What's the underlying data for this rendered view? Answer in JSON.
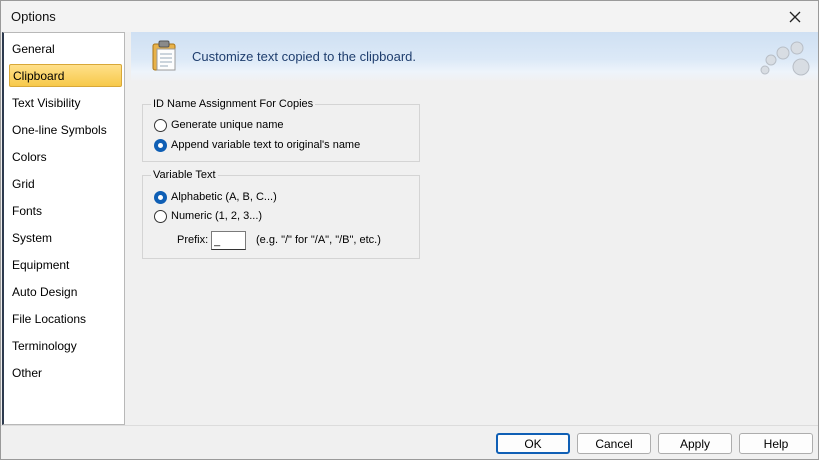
{
  "window": {
    "title": "Options"
  },
  "sidebar": {
    "items": [
      {
        "label": "General"
      },
      {
        "label": "Clipboard",
        "selected": true
      },
      {
        "label": "Text Visibility"
      },
      {
        "label": "One-line Symbols"
      },
      {
        "label": "Colors"
      },
      {
        "label": "Grid"
      },
      {
        "label": "Fonts"
      },
      {
        "label": "System"
      },
      {
        "label": "Equipment"
      },
      {
        "label": "Auto Design"
      },
      {
        "label": "File Locations"
      },
      {
        "label": "Terminology"
      },
      {
        "label": "Other"
      }
    ]
  },
  "banner": {
    "text": "Customize text copied to the clipboard.",
    "icon": "clipboard-icon"
  },
  "id_group": {
    "legend": "ID Name Assignment For Copies",
    "options": [
      {
        "label": "Generate unique name",
        "checked": false
      },
      {
        "label": "Append variable text to original's name",
        "checked": true
      }
    ]
  },
  "variable_group": {
    "legend": "Variable Text",
    "options": [
      {
        "label": "Alphabetic (A, B, C...)",
        "checked": true
      },
      {
        "label": "Numeric (1, 2, 3...)",
        "checked": false
      }
    ],
    "prefix_label": "Prefix:",
    "prefix_value": "_",
    "prefix_hint": "(e.g. \"/\" for \"/A\", \"/B\", etc.)"
  },
  "buttons": {
    "ok": "OK",
    "cancel": "Cancel",
    "apply": "Apply",
    "help": "Help"
  },
  "colors": {
    "accent": "#0f5fb5",
    "selection": "#f7c94a",
    "banner": "#cfe0f3"
  }
}
